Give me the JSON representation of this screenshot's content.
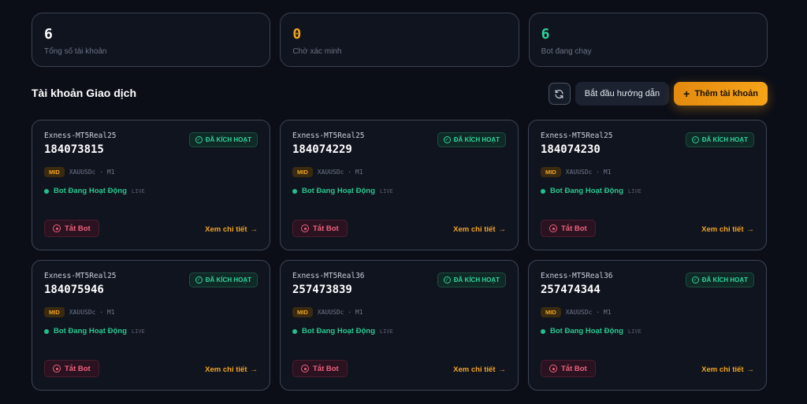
{
  "stats": [
    {
      "value": "6",
      "label": "Tổng số tài khoản",
      "color": "#ffffff"
    },
    {
      "value": "0",
      "label": "Chờ xác minh",
      "color": "#f2a422"
    },
    {
      "value": "6",
      "label": "Bot đang chạy",
      "color": "#2fd39a"
    }
  ],
  "section": {
    "title": "Tài khoản Giao dịch",
    "guide_label": "Bắt đầu hướng dẫn",
    "add_label": "Thêm tài khoản",
    "refresh_icon": "refresh-icon"
  },
  "accounts": [
    {
      "server": "Exness-MT5Real25",
      "login": "184073815",
      "badge": "ĐÃ KÍCH HOẠT",
      "tier": "MID",
      "pair": "XAUUSDc · M1",
      "status": "Bot Đang Hoạt Động",
      "live": "LIVE",
      "off_label": "Tắt Bot",
      "detail_label": "Xem chi tiết"
    },
    {
      "server": "Exness-MT5Real25",
      "login": "184074229",
      "badge": "ĐÃ KÍCH HOẠT",
      "tier": "MID",
      "pair": "XAUUSDc · M1",
      "status": "Bot Đang Hoạt Động",
      "live": "LIVE",
      "off_label": "Tắt Bot",
      "detail_label": "Xem chi tiết"
    },
    {
      "server": "Exness-MT5Real25",
      "login": "184074230",
      "badge": "ĐÃ KÍCH HOẠT",
      "tier": "MID",
      "pair": "XAUUSDc · M1",
      "status": "Bot Đang Hoạt Động",
      "live": "LIVE",
      "off_label": "Tắt Bot",
      "detail_label": "Xem chi tiết"
    },
    {
      "server": "Exness-MT5Real25",
      "login": "184075946",
      "badge": "ĐÃ KÍCH HOẠT",
      "tier": "MID",
      "pair": "XAUUSDc · M1",
      "status": "Bot Đang Hoạt Động",
      "live": "LIVE",
      "off_label": "Tắt Bot",
      "detail_label": "Xem chi tiết"
    },
    {
      "server": "Exness-MT5Real36",
      "login": "257473839",
      "badge": "ĐÃ KÍCH HOẠT",
      "tier": "MID",
      "pair": "XAUUSDc · M1",
      "status": "Bot Đang Hoạt Động",
      "live": "LIVE",
      "off_label": "Tắt Bot",
      "detail_label": "Xem chi tiết"
    },
    {
      "server": "Exness-MT5Real36",
      "login": "257474344",
      "badge": "ĐÃ KÍCH HOẠT",
      "tier": "MID",
      "pair": "XAUUSDc · M1",
      "status": "Bot Đang Hoạt Động",
      "live": "LIVE",
      "off_label": "Tắt Bot",
      "detail_label": "Xem chi tiết"
    }
  ]
}
